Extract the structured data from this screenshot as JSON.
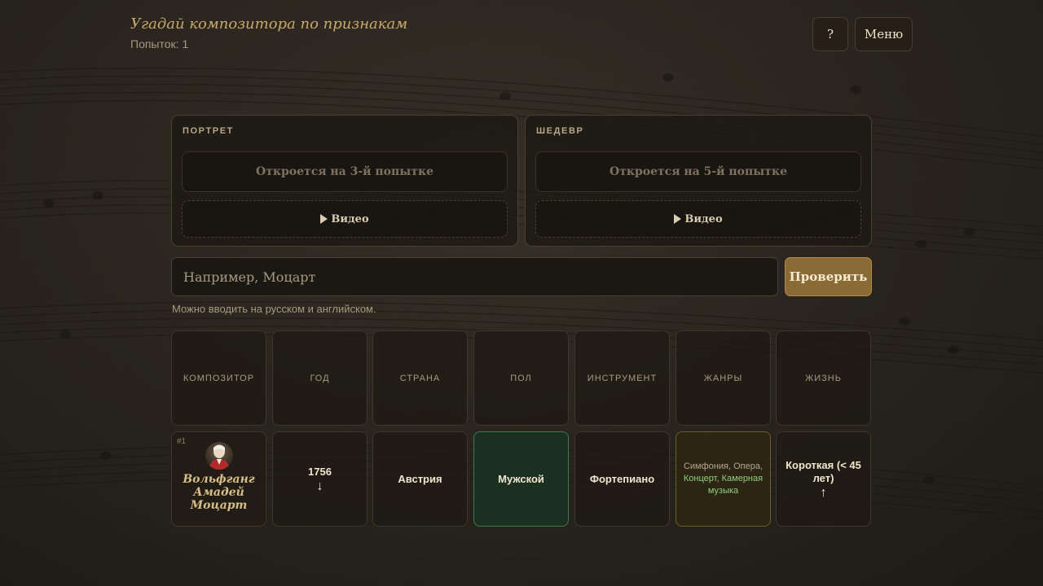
{
  "header": {
    "title": "Угадай композитора по признакам",
    "attempts": "Попыток: 1",
    "help_label": "?",
    "menu_label": "Меню"
  },
  "panels": {
    "portrait": {
      "label": "ПОРТРЕТ",
      "locked_text": "Откроется на 3-й попытке",
      "video_label": "Видео"
    },
    "masterpiece": {
      "label": "ШЕДЕВР",
      "locked_text": "Откроется на 5-й попытке",
      "video_label": "Видео"
    }
  },
  "guess": {
    "placeholder": "Например, Моцарт",
    "value": "",
    "submit_label": "Проверить",
    "hint": "Можно вводить на русском и английском."
  },
  "columns": [
    "КОМПОЗИТОР",
    "ГОД",
    "СТРАНА",
    "ПОЛ",
    "ИНСТРУМЕНТ",
    "ЖАНРЫ",
    "ЖИЗНЬ"
  ],
  "guesses": [
    {
      "rank": "#1",
      "composer_lines": [
        "Вольфганг",
        "Амадей",
        "Моцарт"
      ],
      "year": "1756",
      "year_arrow": "↓",
      "country": "Австрия",
      "sex": "Мужской",
      "instrument": "Фортепиано",
      "genres": [
        {
          "text": "Симфония",
          "match": false
        },
        {
          "text": "Опера",
          "match": false
        },
        {
          "text": "Концерт",
          "match": true
        },
        {
          "text": "Камерная музыка",
          "match": true
        }
      ],
      "life": "Короткая (< 45 лет)",
      "life_arrow": "↑"
    }
  ],
  "colors": {
    "accent": "#c9a86a",
    "match": "#3f7a4c",
    "partial": "#6f5d2b",
    "submit": "#8a6a35"
  }
}
